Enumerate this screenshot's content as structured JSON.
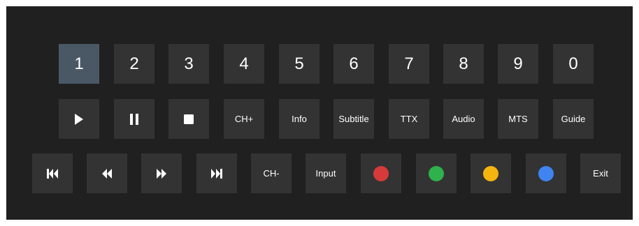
{
  "keypad": {
    "digits": [
      "1",
      "2",
      "3",
      "4",
      "5",
      "6",
      "7",
      "8",
      "9",
      "0"
    ],
    "selected_digit": "1",
    "row2": {
      "play_icon": "play-icon",
      "pause_icon": "pause-icon",
      "stop_icon": "stop-icon",
      "ch_plus": "CH+",
      "info": "Info",
      "subtitle": "Subtitle",
      "ttx": "TTX",
      "audio": "Audio",
      "mts": "MTS",
      "guide": "Guide"
    },
    "row3": {
      "prev_icon": "skip-previous-icon",
      "rewind_icon": "rewind-icon",
      "fast_forward_icon": "fast-forward-icon",
      "next_icon": "skip-next-icon",
      "ch_minus": "CH-",
      "input": "Input",
      "red_color": "#d63a3a",
      "green_color": "#2fb14c",
      "yellow_color": "#f5b50f",
      "blue_color": "#3f84f0",
      "exit": "Exit"
    }
  },
  "colors": {
    "panel_background": "#202020",
    "key_background": "#333333",
    "key_selected_background": "#4a5866",
    "text": "#ffffff"
  }
}
